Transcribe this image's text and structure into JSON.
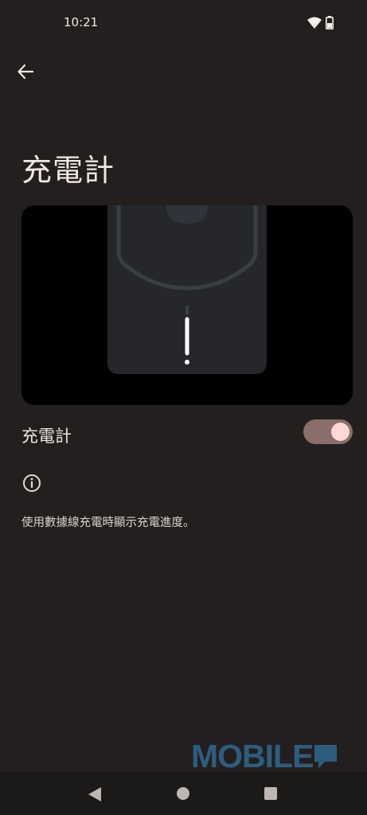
{
  "status_bar": {
    "time": "10:21",
    "wifi_icon": "wifi-icon",
    "battery_icon": "battery-icon"
  },
  "header": {
    "back_icon": "arrow-back-icon",
    "title": "充電計"
  },
  "hero": {
    "illustration": "phone-charging-indicator"
  },
  "setting": {
    "label": "充電計",
    "enabled": true
  },
  "info": {
    "icon": "info-icon",
    "description": "使用數據線充電時顯示充電進度。"
  },
  "watermark": {
    "text": "MOBILE"
  },
  "colors": {
    "background": "#231f1f",
    "toggle_track": "#8b6e69",
    "toggle_thumb": "#ffd8d6",
    "watermark": "#2d5d7e"
  },
  "nav_bar": {
    "back": "nav-back-icon",
    "home": "nav-home-icon",
    "recents": "nav-recents-icon"
  }
}
